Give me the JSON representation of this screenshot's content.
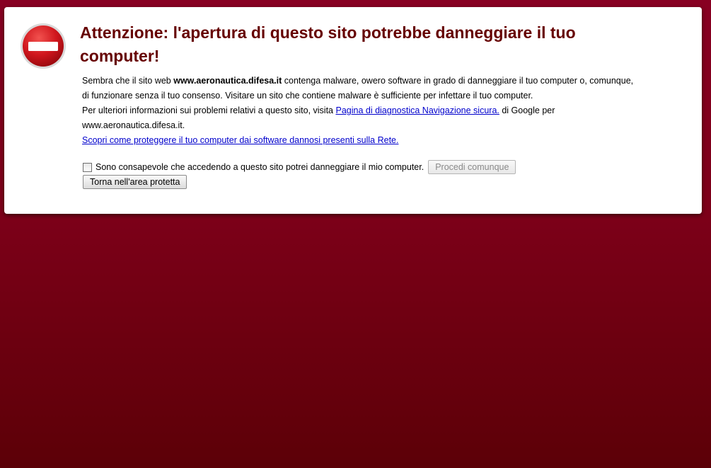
{
  "colors": {
    "background_top": "#880022",
    "background_bottom": "#5c0007",
    "title": "#660000",
    "link": "#0000cc",
    "icon_red": "#c8141c"
  },
  "warning": {
    "icon": "stop-sign-icon",
    "title": "Attenzione: l'apertura di questo sito potrebbe danneggiare il tuo computer!",
    "intro_before": "Sembra che il sito web ",
    "site": "www.aeronautica.difesa.it",
    "intro_after": " contenga malware, owero software in grado di danneggiare il tuo computer o, comunque, di funzionare senza il tuo consenso. Visitare un sito che contiene malware è sufficiente per infettare il tuo computer.",
    "more_info_before": "Per ulteriori informazioni sui problemi relativi a questo sito, visita ",
    "diagnostic_link": "Pagina di diagnostica Navigazione sicura.",
    "more_info_after": " di Google per www.aeronautica.difesa.it.",
    "protect_link": "Scopri come proteggere il tuo computer dai software dannosi presenti sulla Rete."
  },
  "confirm": {
    "checked": false,
    "label": "Sono consapevole che accedendo a questo sito potrei danneggiare il mio computer.",
    "proceed_button": "Procedi comunque"
  },
  "back_button": "Torna nell'area protetta"
}
